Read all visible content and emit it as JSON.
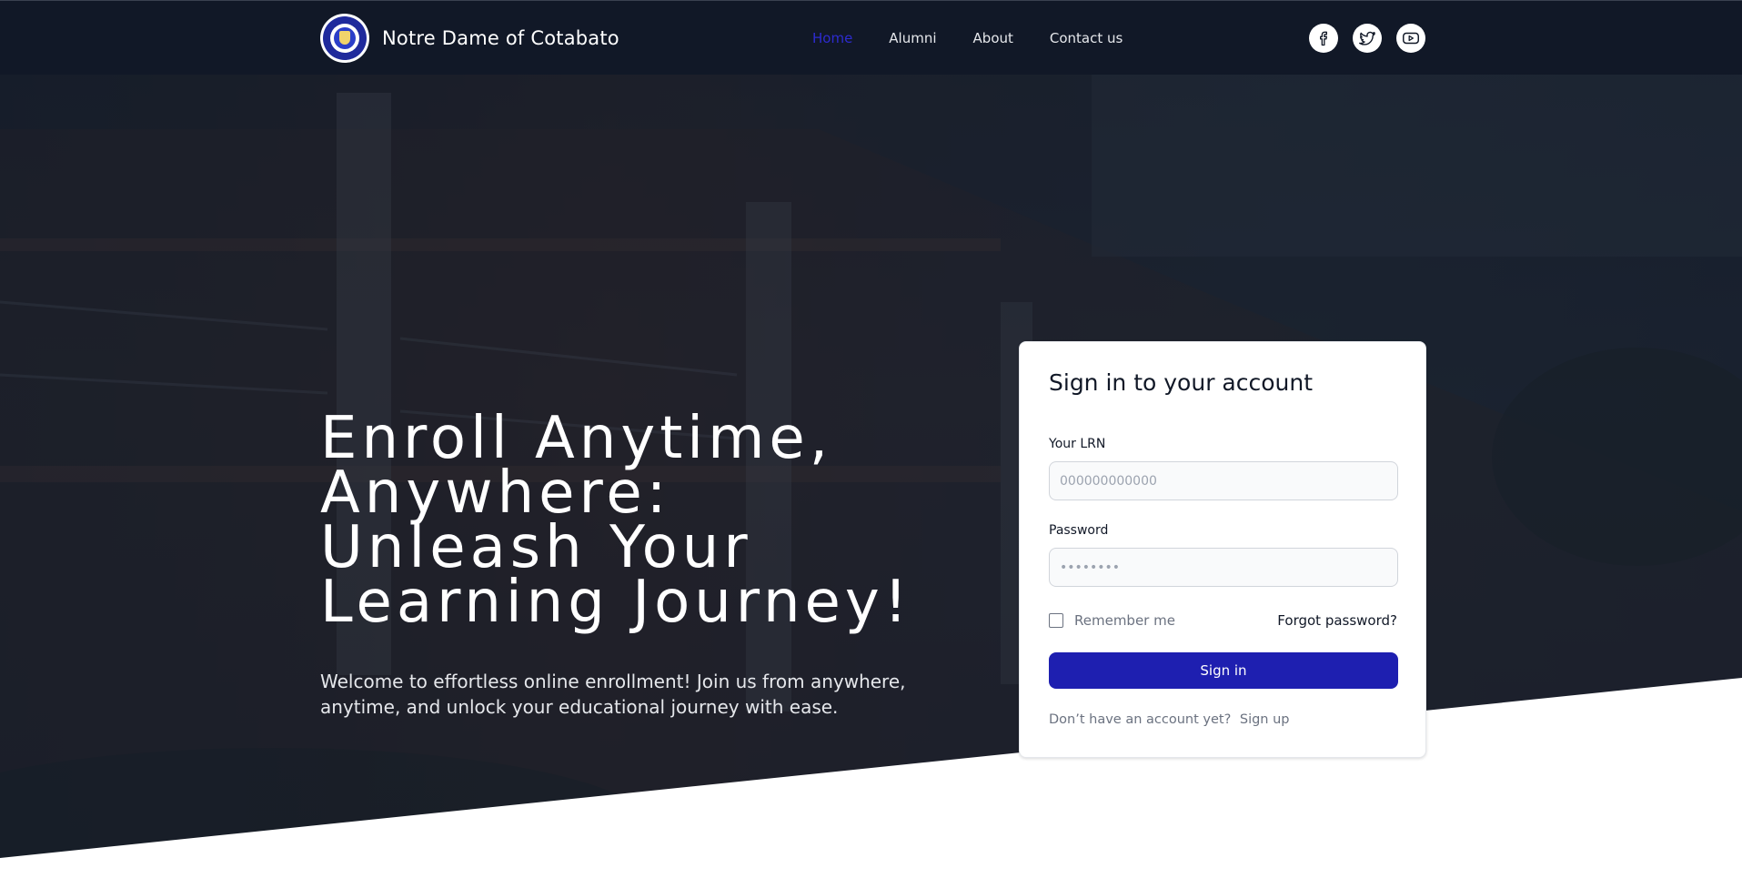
{
  "navbar": {
    "brand_name": "Notre Dame of Cotabato",
    "logo_icon": "school-seal-icon",
    "links": [
      {
        "label": "Home",
        "active": true
      },
      {
        "label": "Alumni",
        "active": false
      },
      {
        "label": "About",
        "active": false
      },
      {
        "label": "Contact us",
        "active": false
      }
    ],
    "socials": [
      "facebook-icon",
      "twitter-icon",
      "youtube-icon"
    ]
  },
  "hero": {
    "headline": "Enroll Anytime, Anywhere: Unleash Your Learning Journey!",
    "subtext": "Welcome to effortless online enrollment! Join us from anywhere, anytime, and unlock your educational journey with ease."
  },
  "signin": {
    "title": "Sign in to your account",
    "lrn_label": "Your LRN",
    "lrn_placeholder": "000000000000",
    "password_label": "Password",
    "password_placeholder": "••••••••",
    "remember_label": "Remember me",
    "forgot_label": "Forgot password?",
    "button_label": "Sign in",
    "signup_prompt": "Don’t have an account yet?",
    "signup_link": "Sign up"
  },
  "colors": {
    "navbar_bg": "#111827",
    "active_link": "#2d2bcf",
    "primary_button": "#1e1fb0"
  }
}
